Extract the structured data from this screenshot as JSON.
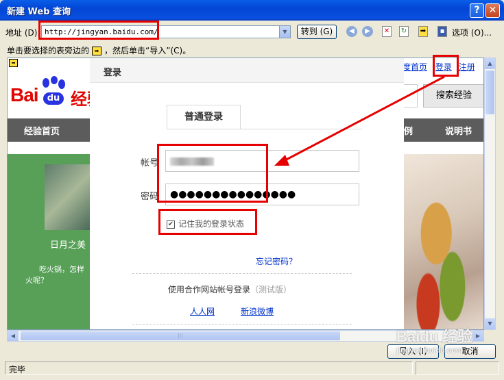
{
  "window": {
    "title": "新建 Web 查询",
    "help": "?",
    "close": "✕"
  },
  "address": {
    "label": "地址 (D):",
    "value": "http://jingyan.baidu.com/",
    "go": "转到 (G)",
    "options": "选项 (O)..."
  },
  "hint": {
    "before": "单击要选择的表旁边的",
    "after": "，然后单击“导入”(C)。"
  },
  "page": {
    "logo_text": "Bai",
    "logo_du": "du",
    "logo_jing": "经验",
    "nav": [
      "经验首页"
    ],
    "nav_right": [
      "例",
      "说明书"
    ],
    "top_links": {
      "home": "度首页",
      "login": "登录",
      "register": "注册"
    },
    "search_btn": "搜索经验",
    "green_title": "日月之美",
    "green_text1": "吃火锅，怎样",
    "green_text2": "火呢？"
  },
  "login": {
    "title": "登录",
    "tab": "普通登录",
    "username_label": "帐号",
    "password_label": "密码",
    "password_value": "●●●●●●●●●●●●●●●",
    "remember": "记住我的登录状态",
    "forgot": "忘记密码？",
    "partner": "使用合作网站帐号登录",
    "partner_beta": "（测试版）",
    "renren": "人人网",
    "weibo": "新浪微博"
  },
  "buttons": {
    "import": "导入 (I)",
    "cancel": "取消"
  },
  "status": {
    "text": "完毕"
  },
  "watermark": "Baidu 经验",
  "watermark_url": "jingyan.baidu.com",
  "colors": {
    "annotation_red": "#e60000",
    "baidu_red": "#e10601",
    "baidu_blue": "#2932e1"
  }
}
